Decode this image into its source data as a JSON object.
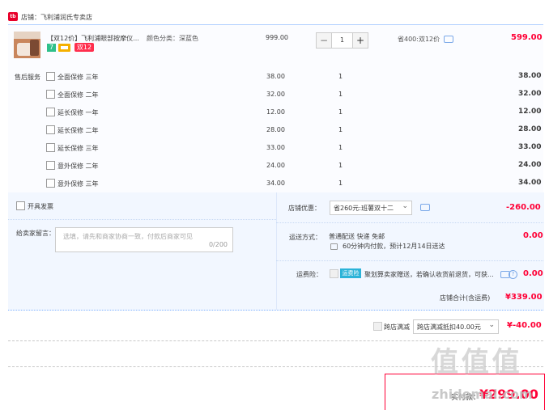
{
  "shop": {
    "icon_text": "tb",
    "label": "店铺：飞利浦润氏专卖店"
  },
  "product": {
    "title": "【双12价】飞利浦眼部按摩仪...",
    "spec": "颜色分类：深蓝色",
    "price": "999.00",
    "quantity": "1",
    "discount": "省400:双12价",
    "total": "599.00",
    "badge_num": "7",
    "badge_promo": "双12"
  },
  "services": {
    "label": "售后服务",
    "items": [
      {
        "name": "全面保修 三年",
        "price": "38.00",
        "qty": "1",
        "total": "38.00"
      },
      {
        "name": "全面保修 二年",
        "price": "32.00",
        "qty": "1",
        "total": "32.00"
      },
      {
        "name": "延长保修 一年",
        "price": "12.00",
        "qty": "1",
        "total": "12.00"
      },
      {
        "name": "延长保修 二年",
        "price": "28.00",
        "qty": "1",
        "total": "28.00"
      },
      {
        "name": "延长保修 三年",
        "price": "33.00",
        "qty": "1",
        "total": "33.00"
      },
      {
        "name": "意外保修 二年",
        "price": "24.00",
        "qty": "1",
        "total": "24.00"
      },
      {
        "name": "意外保修 三年",
        "price": "34.00",
        "qty": "1",
        "total": "34.00"
      }
    ]
  },
  "invoice": {
    "label": "开具发票"
  },
  "message": {
    "label": "给卖家留言：",
    "placeholder": "选填，请先和商家协商一致，付款后商家可见",
    "counter": "0/200"
  },
  "shop_promo": {
    "label": "店铺优惠：",
    "selected": "省260元:班薯双十二",
    "amount": "-260.00"
  },
  "delivery": {
    "label": "运送方式：",
    "method": "普通配送 快递 免邮",
    "eta": "60分钟内付款，预计12月14日送达",
    "amount": "0.00"
  },
  "insurance": {
    "label": "运费险：",
    "tag": "运费险",
    "text": "聚划算卖家赠送，若确认收货前退货，可获...",
    "amount": "0.00"
  },
  "shop_total": {
    "label": "店铺合计(含运费)",
    "amount": "¥339.00"
  },
  "cross_shop": {
    "label": "跨店满减",
    "selected": "跨店满减抵扣40.00元",
    "amount": "¥-40.00"
  },
  "payment": {
    "label": "实付款：",
    "amount": "¥299.00"
  },
  "watermark": {
    "text": "值 值 值",
    "domain": "zhidemai.com"
  },
  "colors": {
    "accent": "#ff0036",
    "border_blue": "#b2d1ff",
    "panel_bg": "#fbfcff"
  }
}
